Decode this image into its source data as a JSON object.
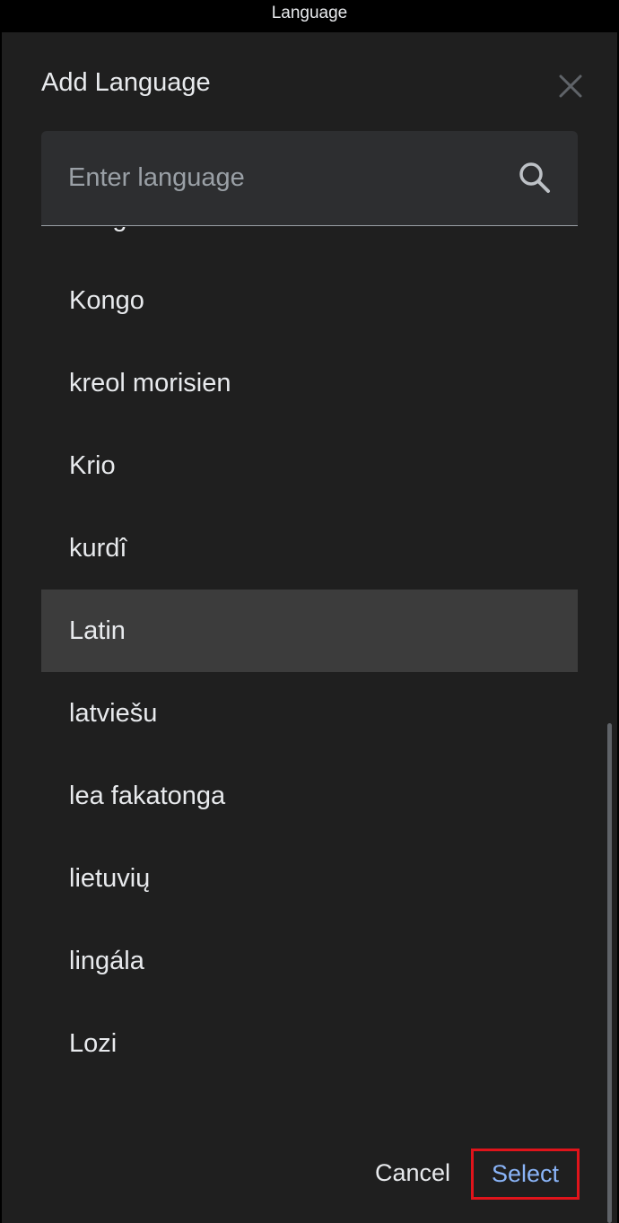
{
  "window": {
    "title": "Language"
  },
  "dialog": {
    "title": "Add Language",
    "close_icon": "close-icon"
  },
  "search": {
    "placeholder": "Enter language",
    "value": "",
    "icon": "search-icon"
  },
  "languages": [
    {
      "label": "Klingon",
      "selected": false
    },
    {
      "label": "Kongo",
      "selected": false
    },
    {
      "label": "kreol morisien",
      "selected": false
    },
    {
      "label": "Krio",
      "selected": false
    },
    {
      "label": "kurdî",
      "selected": false
    },
    {
      "label": "Latin",
      "selected": true
    },
    {
      "label": "latviešu",
      "selected": false
    },
    {
      "label": "lea fakatonga",
      "selected": false
    },
    {
      "label": "lietuvių",
      "selected": false
    },
    {
      "label": "lingála",
      "selected": false
    },
    {
      "label": "Lozi",
      "selected": false
    }
  ],
  "actions": {
    "cancel_label": "Cancel",
    "select_label": "Select"
  },
  "colors": {
    "background": "#1f1f1f",
    "selected_row": "#3c3c3c",
    "accent": "#8ab4f8",
    "highlight_border": "#e0141b"
  }
}
